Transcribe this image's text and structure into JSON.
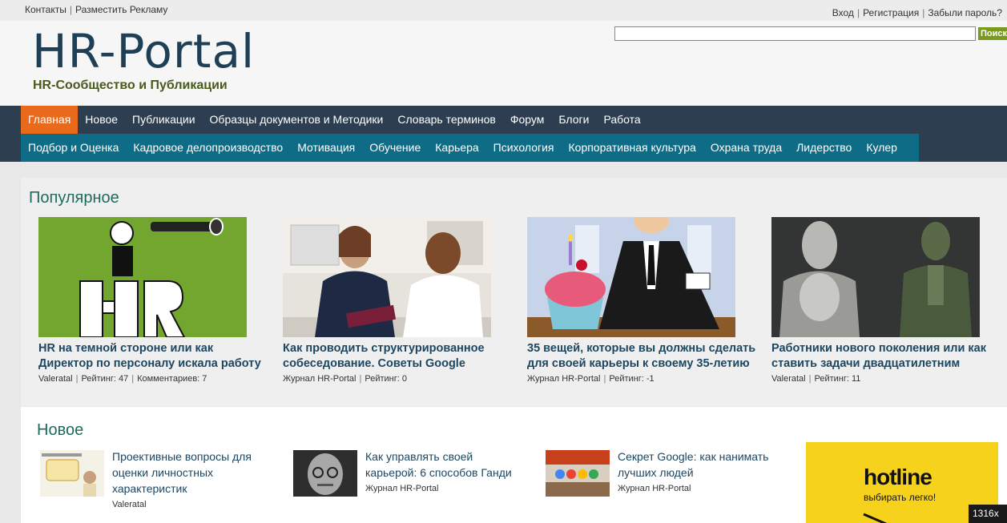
{
  "topbar": {
    "left_links": [
      "Контакты",
      "Разместить Рекламу"
    ],
    "right_links": [
      "Вход",
      "Регистрация",
      "Забыли пароль?"
    ]
  },
  "header": {
    "logo": "HR-Portal",
    "tagline": "HR-Сообщество и Публикации",
    "search_button": "Поиск",
    "search_value": ""
  },
  "nav_main": [
    "Главная",
    "Новое",
    "Публикации",
    "Образцы документов и Методики",
    "Словарь терминов",
    "Форум",
    "Блоги",
    "Работа"
  ],
  "nav_topics": [
    "Подбор и Оценка",
    "Кадровое делопроизводство",
    "Мотивация",
    "Обучение",
    "Карьера",
    "Психология",
    "Корпоративная культура",
    "Охрана труда",
    "Лидерство",
    "Кулер"
  ],
  "popular": {
    "title": "Популярное",
    "cards": [
      {
        "title": "HR на темной стороне или как Директор по персоналу искала работу",
        "author": "Valeratal",
        "rating": "Рейтинг: 47",
        "comments": "Комментариев: 7"
      },
      {
        "title": "Как проводить структурированное собеседование. Советы Google",
        "author": "Журнал HR-Portal",
        "rating": "Рейтинг: 0",
        "comments": ""
      },
      {
        "title": "35 вещей, которые вы должны сделать для своей карьеры к своему 35-летию",
        "author": "Журнал HR-Portal",
        "rating": "Рейтинг: -1",
        "comments": ""
      },
      {
        "title": "Работники нового поколения или как ставить задачи двадцатилетним",
        "author": "Valeratal",
        "rating": "Рейтинг: 11",
        "comments": ""
      }
    ]
  },
  "new": {
    "title": "Новое",
    "items": [
      {
        "title": "Проективные вопросы для оценки личностных характеристик",
        "author": "Valeratal"
      },
      {
        "title": "Как управлять своей карьерой: 6 способов Ганди",
        "author": "Журнал HR-Portal"
      },
      {
        "title": "Секрет Google: как нанимать лучших людей",
        "author": "Журнал HR-Portal"
      }
    ]
  },
  "ad": {
    "brand": "hotline",
    "slogan": "выбирать легко!"
  },
  "size_badge": "1316x"
}
